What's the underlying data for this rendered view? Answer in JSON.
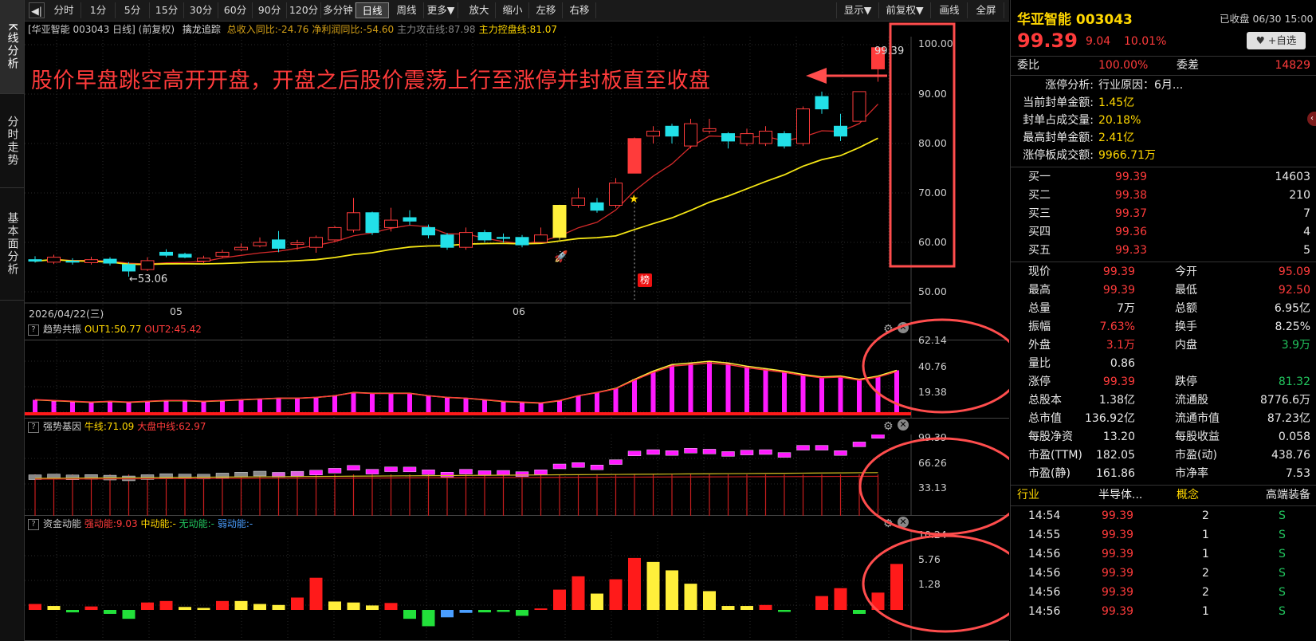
{
  "left_tabs": [
    {
      "label": "K线分析",
      "active": true
    },
    {
      "label": "分时走势",
      "active": false
    },
    {
      "label": "基本面分析",
      "active": false
    }
  ],
  "toolbar": {
    "collapse_icon": "◀|",
    "periods": [
      "分时",
      "1分",
      "5分",
      "15分",
      "30分",
      "60分",
      "90分",
      "120分",
      "多分钟",
      "日线",
      "周线",
      "更多▼"
    ],
    "active_period": "日线",
    "actions": [
      "放大",
      "缩小",
      "左移",
      "右移"
    ],
    "right_actions": [
      "显示▼",
      "前复权▼",
      "画线",
      "全屏"
    ]
  },
  "chart": {
    "header_name": "[华亚智能 003043 日线]",
    "header_adj": "(前复权)",
    "header_indicator": "擒龙追踪",
    "header_stats": [
      {
        "text": "总收入同比:-24.76",
        "color": "#d4a017"
      },
      {
        "text": "净利润同比:-54.60",
        "color": "#d4a017"
      },
      {
        "text": "主力攻击线:87.98",
        "color": "#888888"
      },
      {
        "text": "主力控盘线:81.07",
        "color": "#ffd700"
      }
    ],
    "annotation": "股价早盘跳空高开开盘，开盘之后股价震荡上行至涨停并封板直至收盘",
    "price_axis": [
      "100.00",
      "90.00",
      "80.00",
      "70.00",
      "60.00",
      "50.00"
    ],
    "high_label": "99.39",
    "low_label": "←53.06",
    "date_labels": [
      "2026/04/22(三)",
      "05",
      "06"
    ],
    "bang_label": "榜"
  },
  "chart_data": {
    "type": "candlestick",
    "title": "华亚智能 003043 日线",
    "ylim": [
      50,
      100
    ],
    "candles": [
      [
        56.5,
        56.2,
        57.2,
        55.9
      ],
      [
        56.0,
        57.0,
        57.5,
        55.6
      ],
      [
        56.2,
        56.0,
        56.8,
        55.5
      ],
      [
        55.9,
        56.5,
        57.1,
        55.5
      ],
      [
        56.6,
        55.8,
        57.0,
        55.3
      ],
      [
        55.5,
        54.2,
        56.0,
        53.06
      ],
      [
        54.5,
        56.3,
        57.0,
        54.2
      ],
      [
        58.0,
        57.4,
        58.6,
        57.0
      ],
      [
        57.6,
        57.0,
        57.9,
        56.8
      ],
      [
        56.2,
        56.8,
        57.3,
        55.8
      ],
      [
        57.2,
        58.0,
        58.5,
        56.9
      ],
      [
        58.5,
        59.0,
        59.8,
        58.2
      ],
      [
        59.3,
        60.0,
        61.0,
        59.0
      ],
      [
        60.5,
        58.8,
        62.3,
        58.0
      ],
      [
        59.6,
        59.9,
        60.5,
        58.5
      ],
      [
        59.0,
        61.0,
        61.4,
        57.9
      ],
      [
        60.5,
        63.0,
        63.3,
        60.2
      ],
      [
        62.5,
        66.0,
        69.0,
        62.0
      ],
      [
        66.0,
        62.0,
        66.2,
        61.5
      ],
      [
        63.0,
        64.5,
        67.0,
        62.2
      ],
      [
        65.0,
        64.3,
        66.5,
        63.5
      ],
      [
        63.0,
        61.5,
        63.6,
        60.8
      ],
      [
        61.5,
        59.0,
        61.9,
        58.5
      ],
      [
        59.0,
        62.0,
        63.0,
        58.5
      ],
      [
        62.0,
        60.5,
        62.5,
        60.0
      ],
      [
        61.0,
        60.8,
        61.8,
        60.0
      ],
      [
        61.0,
        59.5,
        61.5,
        59.0
      ],
      [
        60.0,
        61.5,
        63.0,
        60.0
      ],
      [
        61.0,
        67.5,
        67.6,
        60.5
      ],
      [
        67.5,
        69.0,
        71.0,
        67.0
      ],
      [
        68.0,
        66.5,
        69.0,
        66.0
      ],
      [
        67.5,
        72.0,
        73.0,
        67.0
      ],
      [
        74.0,
        81.0,
        81.2,
        74.0
      ],
      [
        81.5,
        82.5,
        83.5,
        80.0
      ],
      [
        83.5,
        81.5,
        84.0,
        80.0
      ],
      [
        79.5,
        84.0,
        85.0,
        79.0
      ],
      [
        82.5,
        83.0,
        85.0,
        82.0
      ],
      [
        82.0,
        80.5,
        82.3,
        79.0
      ],
      [
        80.0,
        82.0,
        83.0,
        79.5
      ],
      [
        80.0,
        82.5,
        83.5,
        79.5
      ],
      [
        82.0,
        79.5,
        82.5,
        79.0
      ],
      [
        80.0,
        87.0,
        87.5,
        79.5
      ],
      [
        89.5,
        87.0,
        90.5,
        86.0
      ],
      [
        83.5,
        81.5,
        86.0,
        80.5
      ],
      [
        84.5,
        90.5,
        90.5,
        84.5
      ],
      [
        95.09,
        99.39,
        99.39,
        92.5
      ]
    ],
    "ma_yellow_last": 81.07,
    "ma_red_last": 87.98
  },
  "ind1": {
    "name": "趋势共振",
    "out1": "OUT1:50.77",
    "out2": "OUT2:45.42",
    "axis": [
      "62.14",
      "40.76",
      "19.38"
    ],
    "values": [
      15,
      14,
      13,
      12,
      13,
      12,
      13,
      14,
      14,
      13,
      14,
      15,
      16,
      17,
      17,
      18,
      20,
      24,
      23,
      23,
      23,
      20,
      18,
      17,
      15,
      13,
      12,
      11,
      14,
      20,
      24,
      29,
      40,
      50,
      58,
      60,
      62,
      60,
      56,
      53,
      50,
      46,
      43,
      44,
      40,
      44,
      51
    ]
  },
  "ind2": {
    "name": "强势基因",
    "line1": "牛线:71.09",
    "line2": "大盘中线:62.97",
    "axis": [
      "99.39",
      "66.26",
      "33.13"
    ]
  },
  "ind3": {
    "name": "资金动能",
    "s1": "强动能:9.03",
    "s2": "中动能:-",
    "s3": "无动能:-",
    "s4": "弱动能:-",
    "axis": [
      "10.24",
      "5.76",
      "1.28"
    ],
    "bars": [
      [
        1.2,
        "r"
      ],
      [
        0.8,
        "y"
      ],
      [
        -0.5,
        "g"
      ],
      [
        0.7,
        "r"
      ],
      [
        -0.8,
        "g"
      ],
      [
        -1.8,
        "g"
      ],
      [
        1.5,
        "r"
      ],
      [
        1.8,
        "r"
      ],
      [
        0.6,
        "y"
      ],
      [
        0.4,
        "y"
      ],
      [
        1.8,
        "r"
      ],
      [
        1.8,
        "y"
      ],
      [
        1.2,
        "y"
      ],
      [
        1.0,
        "y"
      ],
      [
        2.5,
        "r"
      ],
      [
        6.5,
        "r"
      ],
      [
        1.7,
        "y"
      ],
      [
        1.5,
        "y"
      ],
      [
        0.9,
        "y"
      ],
      [
        1.4,
        "r"
      ],
      [
        -1.8,
        "g"
      ],
      [
        -3.3,
        "g"
      ],
      [
        -1.5,
        "b"
      ],
      [
        -0.6,
        "b"
      ],
      [
        -0.5,
        "g"
      ],
      [
        -0.4,
        "g"
      ],
      [
        -1.2,
        "g"
      ],
      [
        0.3,
        "r"
      ],
      [
        4.1,
        "r"
      ],
      [
        6.8,
        "r"
      ],
      [
        3.3,
        "y"
      ],
      [
        6.2,
        "r"
      ],
      [
        10.5,
        "r"
      ],
      [
        9.7,
        "y"
      ],
      [
        8.0,
        "y"
      ],
      [
        5.3,
        "y"
      ],
      [
        3.8,
        "y"
      ],
      [
        0.8,
        "y"
      ],
      [
        0.8,
        "y"
      ],
      [
        1.0,
        "r"
      ],
      [
        -0.4,
        "g"
      ],
      [
        0,
        "n"
      ],
      [
        2.8,
        "r"
      ],
      [
        4.4,
        "r"
      ],
      [
        -0.8,
        "g"
      ],
      [
        3.5,
        "r"
      ],
      [
        9.3,
        "r"
      ]
    ]
  },
  "right": {
    "stock_name": "华亚智能 003043",
    "status": "已收盘 06/30 15:00",
    "price": "99.39",
    "change": "9.04",
    "pct": "10.01%",
    "watch_btn": "♥ +自选",
    "weibi_label": "委比",
    "weibi": "100.00%",
    "weicha_label": "委差",
    "weicha": "14829",
    "limit_up": [
      {
        "k": "涨停分析:",
        "v": "行业原因：6月..."
      },
      {
        "k": "当前封单金额:",
        "v": "1.45亿"
      },
      {
        "k": "封单占成交量:",
        "v": "20.18%"
      },
      {
        "k": "最高封单金额:",
        "v": "2.41亿"
      },
      {
        "k": "涨停板成交额:",
        "v": "9966.71万"
      }
    ],
    "bids": [
      {
        "k": "买一",
        "p": "99.39",
        "v": "14603"
      },
      {
        "k": "买二",
        "p": "99.38",
        "v": "210"
      },
      {
        "k": "买三",
        "p": "99.37",
        "v": "7"
      },
      {
        "k": "买四",
        "p": "99.36",
        "v": "4"
      },
      {
        "k": "买五",
        "p": "99.33",
        "v": "5"
      }
    ],
    "quote": [
      [
        {
          "k": "现价",
          "v": "99.39",
          "c": "red"
        },
        {
          "k": "今开",
          "v": "95.09",
          "c": "red"
        }
      ],
      [
        {
          "k": "最高",
          "v": "99.39",
          "c": "red"
        },
        {
          "k": "最低",
          "v": "92.50",
          "c": "red"
        }
      ],
      [
        {
          "k": "总量",
          "v": "7万",
          "c": "white"
        },
        {
          "k": "总额",
          "v": "6.95亿",
          "c": "white"
        }
      ],
      [
        {
          "k": "振幅",
          "v": "7.63%",
          "c": "red"
        },
        {
          "k": "换手",
          "v": "8.25%",
          "c": "white"
        }
      ],
      [
        {
          "k": "外盘",
          "v": "3.1万",
          "c": "red"
        },
        {
          "k": "内盘",
          "v": "3.9万",
          "c": "green"
        }
      ],
      [
        {
          "k": "量比",
          "v": "0.86",
          "c": "white"
        },
        {
          "k": "",
          "v": "",
          "c": "white"
        }
      ],
      [
        {
          "k": "涨停",
          "v": "99.39",
          "c": "red"
        },
        {
          "k": "跌停",
          "v": "81.32",
          "c": "green"
        }
      ],
      [
        {
          "k": "总股本",
          "v": "1.38亿",
          "c": "white"
        },
        {
          "k": "流通股",
          "v": "8776.6万",
          "c": "white"
        }
      ],
      [
        {
          "k": "总市值",
          "v": "136.92亿",
          "c": "white"
        },
        {
          "k": "流通市值",
          "v": "87.23亿",
          "c": "white"
        }
      ],
      [
        {
          "k": "每股净资",
          "v": "13.20",
          "c": "white"
        },
        {
          "k": "每股收益",
          "v": "0.058",
          "c": "white"
        }
      ],
      [
        {
          "k": "市盈(TTM)",
          "v": "182.05",
          "c": "white"
        },
        {
          "k": "市盈(动)",
          "v": "438.76",
          "c": "white"
        }
      ],
      [
        {
          "k": "市盈(静)",
          "v": "161.86",
          "c": "white"
        },
        {
          "k": "市净率",
          "v": "7.53",
          "c": "white"
        }
      ]
    ],
    "industry_label": "行业",
    "industry": "半导体...",
    "concept_label": "概念",
    "concept": "高端装备",
    "ticks": [
      {
        "t": "14:54",
        "p": "99.39",
        "v": "2",
        "s": "S"
      },
      {
        "t": "14:55",
        "p": "99.39",
        "v": "1",
        "s": "S"
      },
      {
        "t": "14:56",
        "p": "99.39",
        "v": "1",
        "s": "S"
      },
      {
        "t": "14:56",
        "p": "99.39",
        "v": "2",
        "s": "S"
      },
      {
        "t": "14:56",
        "p": "99.39",
        "v": "2",
        "s": "S"
      },
      {
        "t": "14:56",
        "p": "99.39",
        "v": "1",
        "s": "S"
      }
    ]
  }
}
